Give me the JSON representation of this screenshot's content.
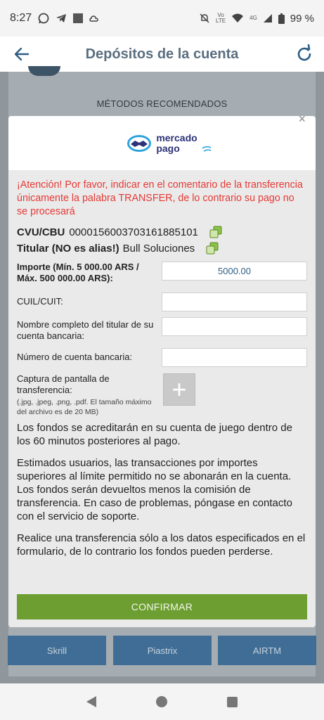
{
  "status_bar": {
    "time": "8:27",
    "network": "4G",
    "battery": "99 %"
  },
  "header": {
    "title": "Depósitos de la cuenta"
  },
  "background": {
    "section_label": "MÉTODOS RECOMENDADOS",
    "method_buttons": [
      "Skrill",
      "Piastrix",
      "AIRTM"
    ]
  },
  "modal": {
    "logo": {
      "line1": "mercado",
      "line2": "pago"
    },
    "warning": "¡Atención! Por favor, indicar en el comentario de la transferencia únicamente la palabra TRANSFER, de lo contrario su pago no se procesará",
    "cbu": {
      "label": "CVU/CBU",
      "value": "0000156003703161885101"
    },
    "titular": {
      "label": "Titular (NO es alias!)",
      "value": "Bull Soluciones"
    },
    "fields": {
      "importe": {
        "label": "Importe (Mín. 5 000.00 ARS / Máx. 500 000.00 ARS):",
        "value": "5000.00"
      },
      "cuil": {
        "label": "CUIL/CUIT:",
        "value": ""
      },
      "nombre": {
        "label": "Nombre completo del titular de su cuenta bancaria:",
        "value": ""
      },
      "cuenta": {
        "label": "Número de cuenta bancaria:",
        "value": ""
      }
    },
    "upload": {
      "label": "Captura de pantalla de transferencia:",
      "hint": "(.jpg, .jpeg, .png, .pdf. El tamaño máximo del archivo es de 20 MB)",
      "button_glyph": "+"
    },
    "info_paragraphs": [
      "Los fondos se acreditarán en su cuenta de juego dentro de los 60 minutos posteriores al pago.",
      "Estimados usuarios, las transacciones por importes superiores al límite permitido no se abonarán en la cuenta. Los fondos serán devueltos menos la comisión de transferencia. En caso de problemas, póngase en contacto con el servicio de soporte.",
      "Realice una transferencia sólo a los datos especificados en el formulario, de lo contrario los fondos pueden perderse."
    ],
    "confirm_label": "CONFIRMAR",
    "close_glyph": "×"
  },
  "colors": {
    "accent": "#6d9e31",
    "warning": "#e53935",
    "header_text": "#5a6e7f",
    "method_button": "#3f6d96"
  }
}
